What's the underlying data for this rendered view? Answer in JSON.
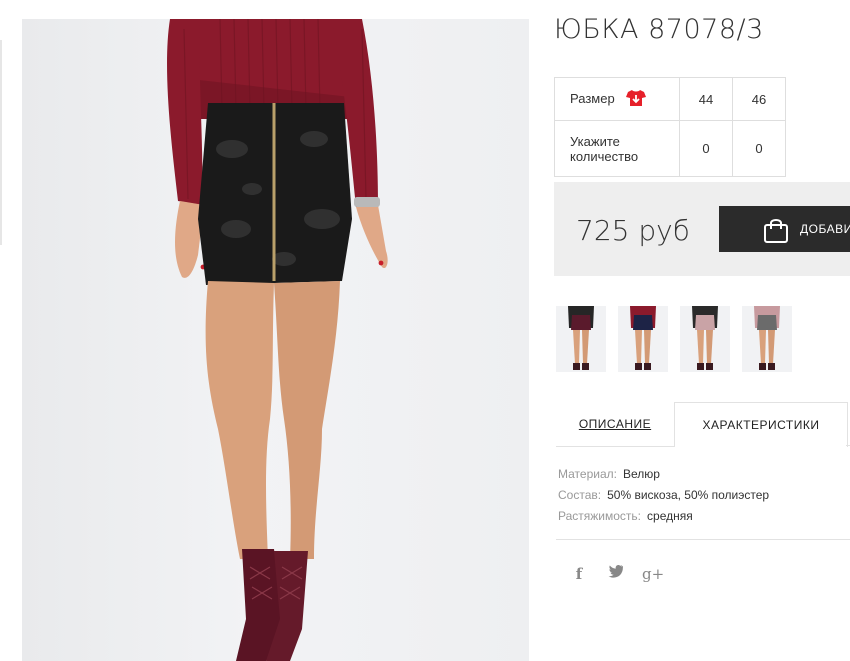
{
  "product": {
    "title": "ЮБКА 87078/3"
  },
  "sizes": {
    "size_label": "Размер",
    "size_icon": "tshirt-size-icon",
    "qty_label": "Укажите количество",
    "options": [
      {
        "size": "44",
        "qty": "0"
      },
      {
        "size": "46",
        "qty": "0"
      }
    ]
  },
  "price": {
    "value": "725 руб",
    "add_to_cart_label": "ДОБАВИТЬ",
    "cart_icon": "shopping-bag-icon"
  },
  "thumbnails": [
    {
      "name": "color-variant-burgundy",
      "skirt_color": "#5a1a2c",
      "top_color": "#262626"
    },
    {
      "name": "color-variant-navy",
      "skirt_color": "#1d2346",
      "top_color": "#8b1a2c"
    },
    {
      "name": "color-variant-pink",
      "skirt_color": "#c9a3a6",
      "top_color": "#2a2a2a"
    },
    {
      "name": "color-variant-grey",
      "skirt_color": "#6b6b6b",
      "top_color": "#c79a9e"
    }
  ],
  "tabs": {
    "description": "ОПИСАНИЕ",
    "characteristics": "ХАРАКТЕРИСТИКИ"
  },
  "specs": [
    {
      "key": "Материал:",
      "value": "Велюр"
    },
    {
      "key": "Состав:",
      "value": "50% вискоза, 50% полиэстер"
    },
    {
      "key": "Растяжимость:",
      "value": "средняя"
    }
  ],
  "social": {
    "facebook": "f",
    "twitter_icon": "twitter-icon",
    "googleplus": "g+"
  },
  "colors": {
    "accent_red": "#e6202a",
    "button_dark": "#2b2b2b",
    "price_bg": "#eeeeee"
  }
}
